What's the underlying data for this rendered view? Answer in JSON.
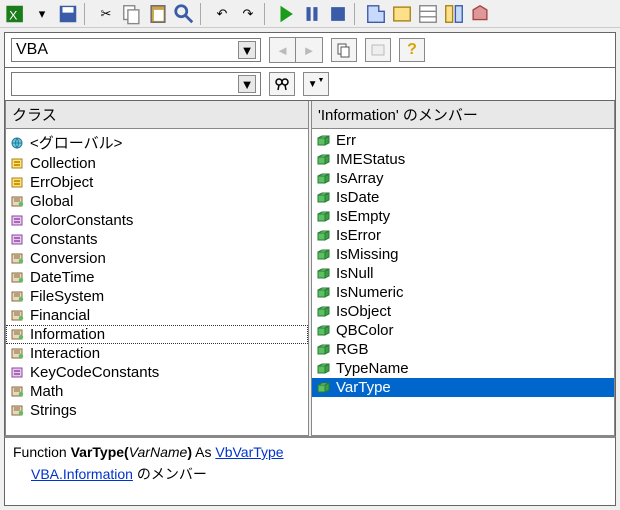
{
  "toolbar": {
    "combo_main": "VBA",
    "combo_search": ""
  },
  "panes": {
    "classes": {
      "header": "クラス",
      "items": [
        {
          "label": "<グローバル>",
          "kind": "global"
        },
        {
          "label": "Collection",
          "kind": "class"
        },
        {
          "label": "ErrObject",
          "kind": "class"
        },
        {
          "label": "Global",
          "kind": "module"
        },
        {
          "label": "ColorConstants",
          "kind": "const"
        },
        {
          "label": "Constants",
          "kind": "const"
        },
        {
          "label": "Conversion",
          "kind": "module"
        },
        {
          "label": "DateTime",
          "kind": "module"
        },
        {
          "label": "FileSystem",
          "kind": "module"
        },
        {
          "label": "Financial",
          "kind": "module"
        },
        {
          "label": "Information",
          "kind": "module",
          "focused": true
        },
        {
          "label": "Interaction",
          "kind": "module"
        },
        {
          "label": "KeyCodeConstants",
          "kind": "const"
        },
        {
          "label": "Math",
          "kind": "module"
        },
        {
          "label": "Strings",
          "kind": "module"
        }
      ]
    },
    "members": {
      "header": "'Information' のメンバー",
      "items": [
        {
          "label": "Err",
          "kind": "method"
        },
        {
          "label": "IMEStatus",
          "kind": "method"
        },
        {
          "label": "IsArray",
          "kind": "method"
        },
        {
          "label": "IsDate",
          "kind": "method"
        },
        {
          "label": "IsEmpty",
          "kind": "method"
        },
        {
          "label": "IsError",
          "kind": "method"
        },
        {
          "label": "IsMissing",
          "kind": "method"
        },
        {
          "label": "IsNull",
          "kind": "method"
        },
        {
          "label": "IsNumeric",
          "kind": "method"
        },
        {
          "label": "IsObject",
          "kind": "method"
        },
        {
          "label": "QBColor",
          "kind": "method"
        },
        {
          "label": "RGB",
          "kind": "method"
        },
        {
          "label": "TypeName",
          "kind": "method"
        },
        {
          "label": "VarType",
          "kind": "method",
          "selected": true
        }
      ]
    }
  },
  "detail": {
    "prefix": "Function ",
    "name": "VarType",
    "paren_open": "(",
    "param": "VarName",
    "paren_close": ")",
    "as": " As ",
    "return_type": "VbVarType",
    "line2_link": "VBA.Information",
    "line2_suffix": " のメンバー"
  }
}
